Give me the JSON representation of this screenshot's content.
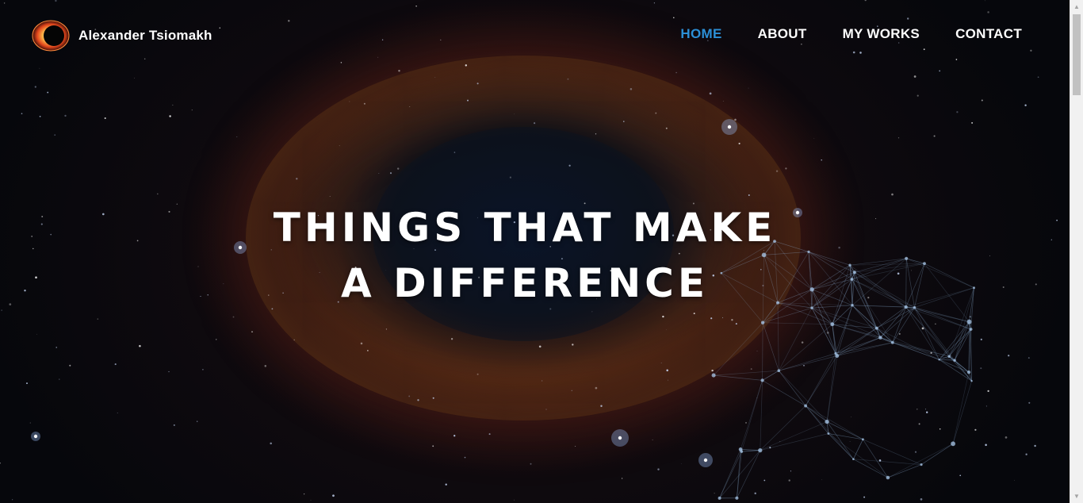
{
  "brand": {
    "name": "Alexander Tsiomakh",
    "logo_icon": "eclipse-logo-icon"
  },
  "nav": {
    "items": [
      {
        "label": "HOME",
        "active": true
      },
      {
        "label": "ABOUT",
        "active": false
      },
      {
        "label": "MY WORKS",
        "active": false
      },
      {
        "label": "CONTACT",
        "active": false
      }
    ],
    "active_color": "#2c8fd6"
  },
  "hero": {
    "line1": "THINGS THAT MAKE",
    "line2": "A DIFFERENCE"
  },
  "scrollbar": {
    "up_icon": "scroll-up-arrow-icon",
    "down_icon": "scroll-down-arrow-icon"
  }
}
